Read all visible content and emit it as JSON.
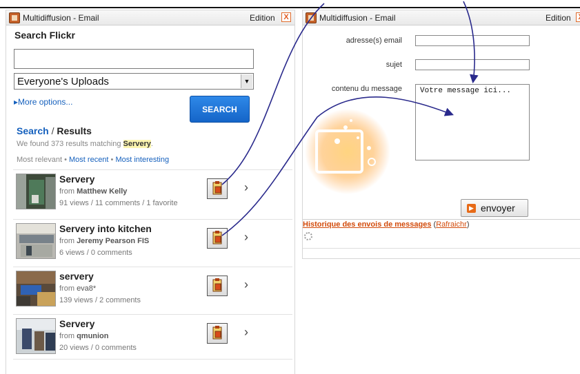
{
  "left_widget": {
    "title": "Multidiffusion - Email",
    "edition_label": "Edition",
    "close_label": "X",
    "search_label": "Search Flickr",
    "search_value": "",
    "select_value": "Everyone's Uploads",
    "more_options": "More options...",
    "search_button": "SEARCH",
    "results_heading_1": "Search",
    "results_heading_sep": "/",
    "results_heading_2": "Results",
    "found_prefix": "We found 373 results matching",
    "found_term": "Servery",
    "found_suffix": ".",
    "sort_prefix": "Most relevant",
    "sort_recent": "Most recent",
    "sort_interesting": "Most interesting",
    "sort_bullet": "•",
    "results": [
      {
        "title": "Servery",
        "from_prefix": "from",
        "author": "Matthew Kelly",
        "stats": "91 views / 11 comments / 1 favorite"
      },
      {
        "title": "Servery into kitchen",
        "from_prefix": "from",
        "author": "Jeremy Pearson FIS",
        "stats": "6 views / 0 comments"
      },
      {
        "title": "servery",
        "from_prefix": "from",
        "author": "eva8*",
        "stats": "139 views / 2 comments"
      },
      {
        "title": "Servery",
        "from_prefix": "from",
        "author": "qmunion",
        "stats": "20 views / 0 comments"
      }
    ],
    "chevron": "›"
  },
  "right_widget": {
    "title": "Multidiffusion - Email",
    "edition_label": "Edition",
    "close_label": "X",
    "email_label": "adresse(s) email",
    "subject_label": "sujet",
    "message_label": "contenu du message",
    "message_value": "Votre message ici...",
    "send_label": "envoyer",
    "history_link": "Historique des envois de messages",
    "paren_open": "(",
    "refresh_link": "Rafraichr",
    "paren_close": ")"
  },
  "colors": {
    "link_blue": "#1560bd",
    "search_button": "#1f75d8",
    "history_orange": "#d24a0a",
    "arrow": "#2a2a8c"
  }
}
